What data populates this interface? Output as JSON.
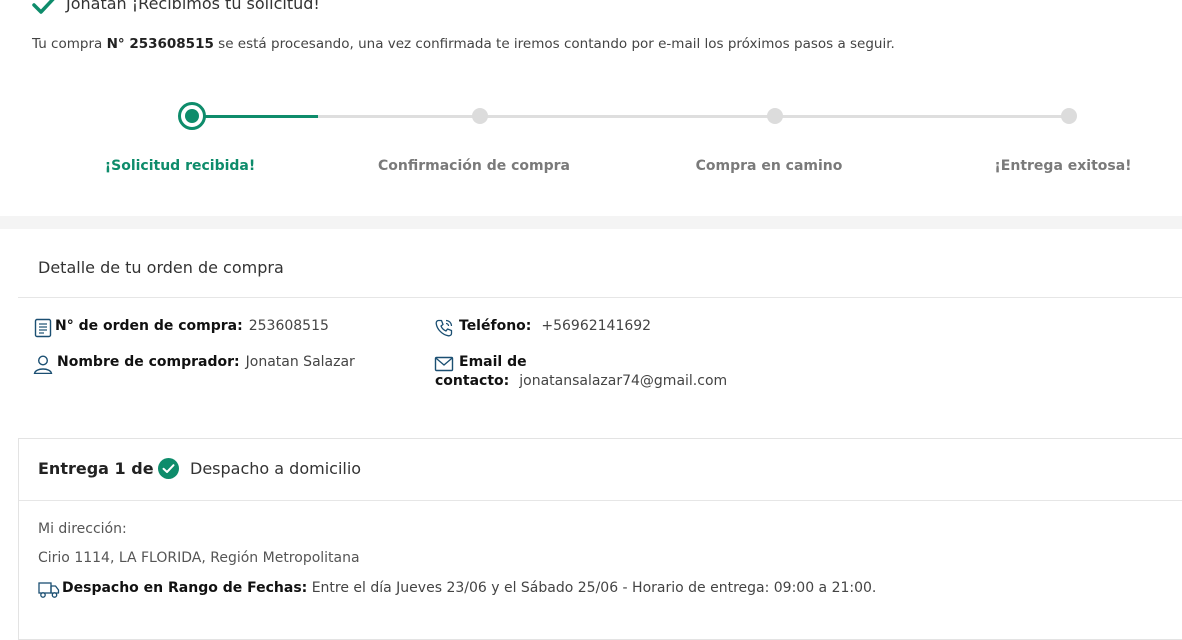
{
  "header": {
    "title": "Jonatan ¡Recibimos tu solicitud!",
    "intro_prefix": "Tu compra",
    "order_ref": "N° 253608515",
    "intro_suffix": "se está procesando, una vez confirmada te iremos contando por e-mail los próximos pasos a seguir."
  },
  "stepper": {
    "progress_fraction": 0.14,
    "steps": [
      {
        "label": "¡Solicitud recibida!",
        "state": "active"
      },
      {
        "label": "Confirmación de compra",
        "state": "pending"
      },
      {
        "label": "Compra en camino",
        "state": "pending"
      },
      {
        "label": "¡Entrega exitosa!",
        "state": "pending"
      }
    ]
  },
  "order": {
    "title": "Detalle de tu orden de compra",
    "order_number_label": "N° de orden de compra:",
    "order_number": "253608515",
    "buyer_label": "Nombre de comprador:",
    "buyer": "Jonatan Salazar",
    "phone_label": "Teléfono:",
    "phone": "+56962141692",
    "email_label_1": "Email de",
    "email_label_2": "contacto:",
    "email": "jonatansalazar74@gmail.com"
  },
  "delivery": {
    "title": "Entrega 1 de 1",
    "method": "Despacho a domicilio",
    "address_label": "Mi dirección:",
    "address": "Cirio 1114, LA FLORIDA, Región Metropolitana",
    "ship_label": "Despacho en Rango de Fechas:",
    "ship_value": "Entre el día Jueves 23/06 y el Sábado 25/06 - Horario de entrega: 09:00 a 21:00."
  },
  "colors": {
    "accent": "#0e8c6b",
    "inactive": "#dcdcdc",
    "icon": "#1b4f72"
  },
  "icons": {
    "header": "checkmark-icon",
    "order_number": "receipt-icon",
    "buyer": "user-icon",
    "phone": "phone-icon",
    "email": "envelope-icon",
    "delivery": "check-circle-icon",
    "ship": "truck-icon"
  }
}
